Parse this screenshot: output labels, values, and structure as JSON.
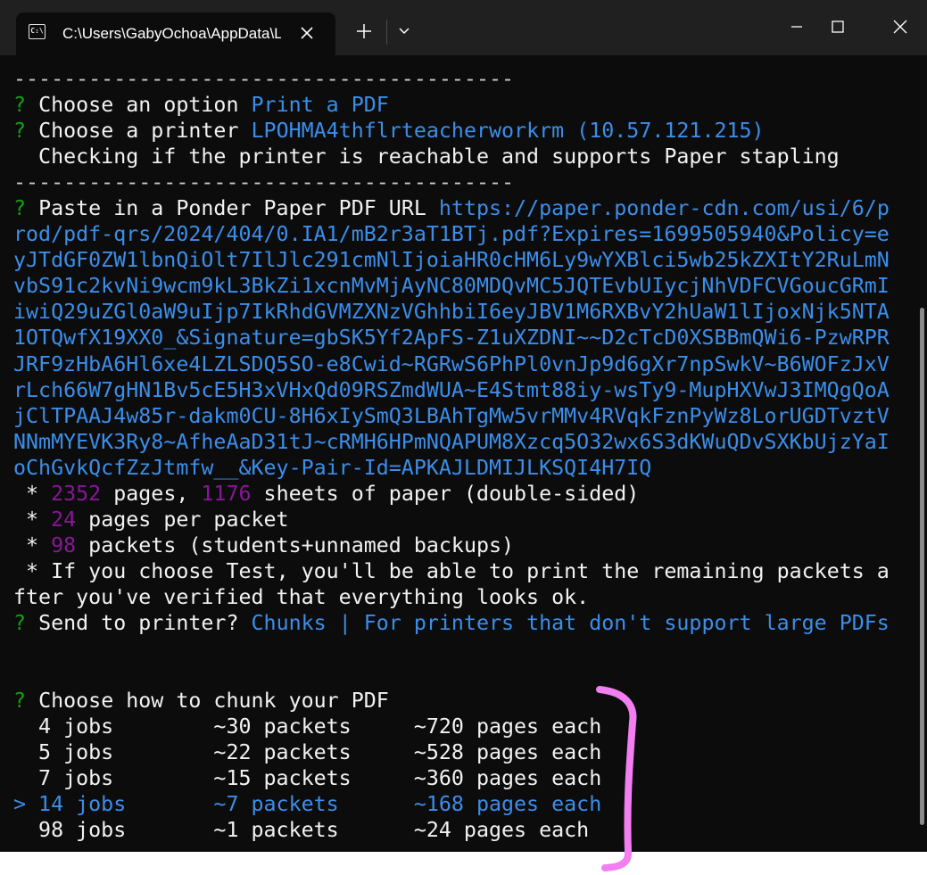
{
  "window": {
    "tab_title": "C:\\Users\\GabyOchoa\\AppData\\Local\\Microsoft\\WindowsApps\\",
    "tab_icon_glyph": "C:\\",
    "new_tab_glyph": "+",
    "colors": {
      "background": "#0c0c0c",
      "titlebar": "#202020",
      "text": "#cccccc",
      "bright_text": "#f2f2f2",
      "prompt_green": "#13a10e",
      "answer_blue": "#3b8eea",
      "number_purple": "#881798",
      "annotation_pink": "#f27ef2"
    }
  },
  "terminal": {
    "separator_1": "----------------------------------------",
    "q_option": {
      "mark": "? ",
      "prompt": "Choose an option ",
      "answer": "Print a PDF"
    },
    "q_printer": {
      "mark": "? ",
      "prompt": "Choose a printer ",
      "answer": "LPOHMA4thflrteacherworkrm (10.57.121.215)"
    },
    "checking": "  Checking if the printer is reachable and supports Paper stapling",
    "separator_2": "----------------------------------------",
    "q_url": {
      "mark": "? ",
      "prompt": "Paste in a Ponder Paper PDF URL ",
      "url_lines": [
        "https://paper.ponder-cdn.com/usi/6/p",
        "rod/pdf-qrs/2024/404/0.IA1/mB2r3aT1BTj.pdf?Expires=1699505940&Policy=e",
        "yJTdGF0ZW1lbnQiOlt7IlJlc291cmNlIjoiaHR0cHM6Ly9wYXBlci5wb25kZXItY2RuLmN",
        "vbS91c2kvNi9wcm9kL3BkZi1xcnMvMjAyNC80MDQvMC5JQTEvbUIycjNhVDFCVGoucGRmI",
        "iwiQ29uZGl0aW9uIjp7IkRhdGVMZXNzVGhhbiI6eyJBV1M6RXBvY2hUaW1lIjoxNjk5NTA",
        "1OTQwfX19XX0_&Signature=gbSK5Yf2ApFS-Z1uXZDNI~~D2cTcD0XSBBmQWi6-PzwRPR",
        "JRF9zHbA6Hl6xe4LZLSDQ5SO-e8Cwid~RGRwS6PhPl0vnJp9d6gXr7npSwkV~B6WOFzJxV",
        "rLch66W7gHN1Bv5cE5H3xVHxQd09RSZmdWUA~E4Stmt88iy-wsTy9-MupHXVwJ3IMQgQoA",
        "jClTPAAJ4w85r-dakm0CU-8H6xIySmQ3LBAhTgMw5vrMMv4RVqkFznPyWz8LorUGDTvztV",
        "NNmMYEVK3Ry8~AfheAaD31tJ~cRMH6HPmNQAPUM8Xzcq5O32wx6S3dKWuQDvSXKbUjzYaI",
        "oChGvkQcfZzJtmfw__&Key-Pair-Id=APKAJLDMIJLKSQI4H7IQ"
      ]
    },
    "stats": {
      "pages_prefix": " * ",
      "pages": "2352",
      "pages_mid": " pages, ",
      "sheets": "1176",
      "sheets_suffix": " sheets of paper (double-sided)",
      "per_packet_prefix": " * ",
      "per_packet": "24",
      "per_packet_suffix": " pages per packet",
      "packets_prefix": " * ",
      "packets": "98",
      "packets_suffix": " packets (students+unnamed backups)",
      "test_prefix": " * If you choose ",
      "test_word": "Test",
      "test_suffix": ", you'll be able to print the remaining packets a",
      "test_line2": "fter you've verified that everything looks ok."
    },
    "q_send": {
      "mark": "? ",
      "prompt": "Send to printer? ",
      "answer": "Chunks | For printers that don't support large PDFs"
    },
    "q_chunk": {
      "mark": "? ",
      "prompt": "Choose how to chunk your PDF"
    },
    "chunk_options": [
      {
        "text": "  4 jobs        ~30 packets     ~720 pages each",
        "selected": false
      },
      {
        "text": "  5 jobs        ~22 packets     ~528 pages each",
        "selected": false
      },
      {
        "text": "  7 jobs        ~15 packets     ~360 pages each",
        "selected": false
      },
      {
        "text": "> 14 jobs       ~7 packets      ~168 pages each",
        "selected": true
      },
      {
        "text": "  98 jobs       ~1 packets      ~24 pages each",
        "selected": false
      }
    ]
  }
}
